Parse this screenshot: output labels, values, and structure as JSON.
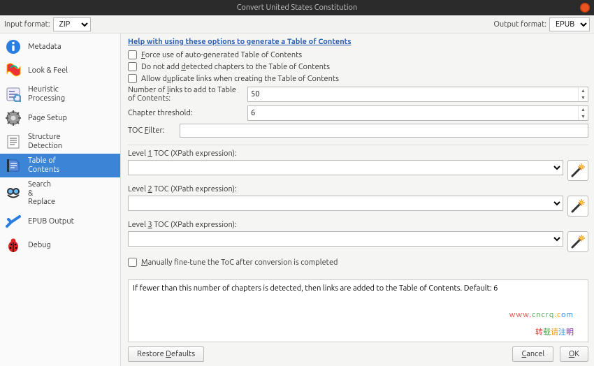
{
  "window": {
    "title": "Convert United States Constitution"
  },
  "formats": {
    "input_label": "Input format:",
    "input_value": "ZIP",
    "output_label": "Output format:",
    "output_value": "EPUB"
  },
  "sidebar": {
    "items": [
      {
        "label": "Metadata"
      },
      {
        "label": "Look & Feel"
      },
      {
        "label": "Heuristic\nProcessing"
      },
      {
        "label": "Page Setup"
      },
      {
        "label": "Structure\nDetection"
      },
      {
        "label": "Table of\nContents"
      },
      {
        "label": "Search\n&\nReplace"
      },
      {
        "label": "EPUB Output"
      },
      {
        "label": "Debug"
      }
    ],
    "active_index": 5
  },
  "toc": {
    "help_link": "Help with using these options to generate a Table of Contents",
    "force_label_pre": "F",
    "force_label_post": "orce use of auto-generated Table of Contents",
    "dontadd_pre": "Do not add ",
    "dontadd_u": "d",
    "dontadd_post": "etected chapters to the Table of Contents",
    "allowdup_pre": "Allow d",
    "allowdup_u": "u",
    "allowdup_post": "plicate links when creating the Table of Contents",
    "numlinks_pre": "Number of ",
    "numlinks_u": "l",
    "numlinks_post": "inks to add to Table of Contents:",
    "numlinks_value": "50",
    "chapter_threshold_label": "Chapter threshold:",
    "chapter_threshold_value": "6",
    "filter_pre": "TOC ",
    "filter_u": "F",
    "filter_post": "ilter:",
    "filter_value": "",
    "levels": [
      {
        "pre": "Level ",
        "u": "1",
        "post": " TOC (XPath expression):"
      },
      {
        "pre": "Level ",
        "u": "2",
        "post": " TOC (XPath expression):"
      },
      {
        "pre": "Level ",
        "u": "3",
        "post": " TOC (XPath expression):"
      }
    ],
    "manual_pre": "",
    "manual_u": "M",
    "manual_post": "anually fine-tune the ToC after conversion is completed",
    "description": "If fewer than this number of chapters is detected, then links are added to the Table of Contents. Default: 6"
  },
  "buttons": {
    "restore_pre": "Restore ",
    "restore_u": "D",
    "restore_post": "efaults",
    "cancel_u": "C",
    "cancel_post": "ancel",
    "ok_u": "O",
    "ok_post": "K"
  },
  "watermark": {
    "url": "www.cncrq.com",
    "zh": "转载请注明"
  }
}
